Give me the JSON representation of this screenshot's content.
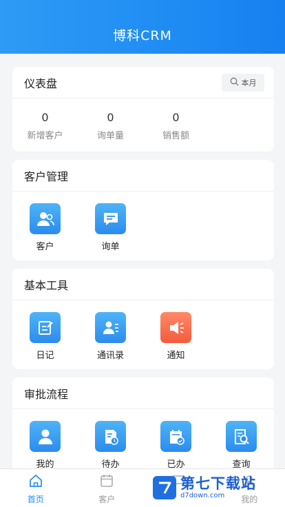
{
  "header": {
    "title": "博科CRM"
  },
  "dashboard": {
    "title": "仪表盘",
    "period_label": "本月",
    "stats": [
      {
        "value": "0",
        "label": "新增客户"
      },
      {
        "value": "0",
        "label": "询单量"
      },
      {
        "value": "0",
        "label": "销售额"
      }
    ]
  },
  "customer_mgmt": {
    "title": "客户管理",
    "items": [
      {
        "label": "客户",
        "icon": "customer-icon"
      },
      {
        "label": "询单",
        "icon": "inquiry-icon"
      }
    ]
  },
  "basic_tools": {
    "title": "基本工具",
    "items": [
      {
        "label": "日记",
        "icon": "diary-icon"
      },
      {
        "label": "通讯录",
        "icon": "contacts-icon"
      },
      {
        "label": "通知",
        "icon": "notice-icon"
      }
    ]
  },
  "approval": {
    "title": "审批流程",
    "items": [
      {
        "label": "我的",
        "icon": "my-approval-icon"
      },
      {
        "label": "待办",
        "icon": "todo-icon"
      },
      {
        "label": "已办",
        "icon": "done-icon"
      },
      {
        "label": "查询",
        "icon": "query-icon"
      }
    ]
  },
  "tabbar": {
    "items": [
      {
        "label": "首页",
        "icon": "home-icon",
        "active": true
      },
      {
        "label": "客户",
        "icon": "calendar-icon",
        "active": false
      },
      {
        "label": "",
        "icon": "chat-icon",
        "active": false
      },
      {
        "label": "我的",
        "icon": "user-icon",
        "active": false
      }
    ]
  },
  "watermark": {
    "main": "第七下载站",
    "sub": "d7down.com"
  },
  "colors": {
    "accent": "#1f8cf3",
    "orange": "#f35a3d"
  }
}
